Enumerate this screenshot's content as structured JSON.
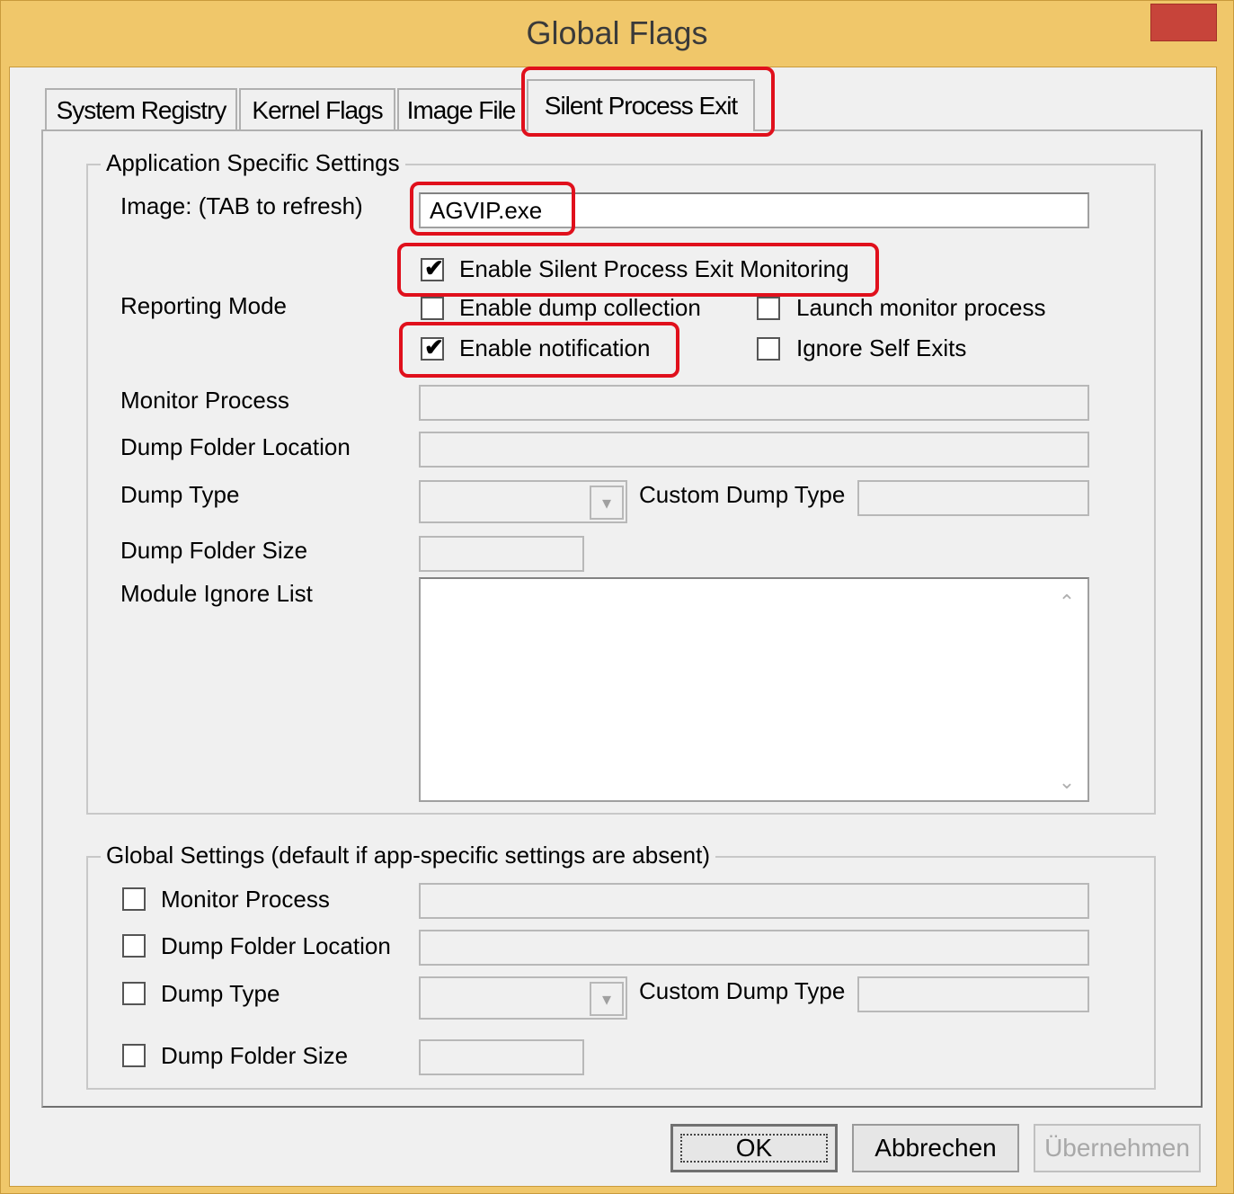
{
  "window": {
    "title": "Global Flags",
    "close_glyph": "✕"
  },
  "tabs": [
    {
      "label": "System Registry"
    },
    {
      "label": "Kernel Flags"
    },
    {
      "label": "Image File"
    },
    {
      "label": "Silent Process Exit"
    }
  ],
  "app_settings": {
    "legend": "Application Specific Settings",
    "image_label": "Image:  (TAB to refresh)",
    "image_value": "AGVIP.exe",
    "reporting_mode_label": "Reporting Mode",
    "enable_monitoring_label": "Enable Silent Process Exit Monitoring",
    "enable_dump_label": "Enable dump collection",
    "launch_monitor_label": "Launch monitor process",
    "enable_notification_label": "Enable notification",
    "ignore_self_exits_label": "Ignore Self Exits",
    "monitor_process_label": "Monitor Process",
    "dump_folder_location_label": "Dump Folder Location",
    "dump_type_label": "Dump Type",
    "custom_dump_type_label": "Custom Dump Type",
    "dump_folder_size_label": "Dump Folder Size",
    "module_ignore_list_label": "Module Ignore List"
  },
  "global_settings": {
    "legend": "Global Settings (default if app-specific settings are absent)",
    "monitor_process_label": "Monitor Process",
    "dump_folder_location_label": "Dump Folder Location",
    "dump_type_label": "Dump Type",
    "custom_dump_type_label": "Custom Dump Type",
    "dump_folder_size_label": "Dump Folder Size"
  },
  "buttons": {
    "ok": "OK",
    "cancel": "Abbrechen",
    "apply": "Übernehmen"
  },
  "icons": {
    "combo_arrow": "▾",
    "scroll_up": "⌃",
    "scroll_down": "⌄",
    "check": "✔"
  },
  "colors": {
    "title_bar": "#f0c76a",
    "close_button": "#c7443a",
    "highlight": "#e0101c"
  }
}
